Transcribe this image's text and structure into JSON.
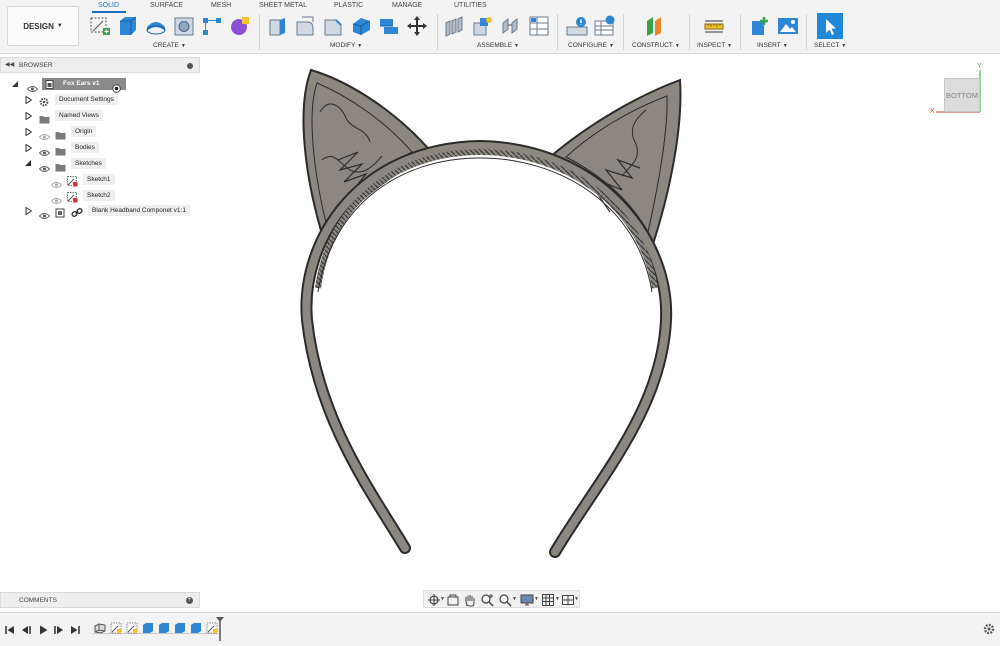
{
  "toolbar": {
    "design_label": "DESIGN",
    "tabs": [
      {
        "label": "SOLID",
        "active": true
      },
      {
        "label": "SURFACE"
      },
      {
        "label": "MESH"
      },
      {
        "label": "SHEET METAL"
      },
      {
        "label": "PLASTIC"
      },
      {
        "label": "MANAGE"
      },
      {
        "label": "UTILITIES"
      }
    ],
    "groups": [
      {
        "label": "CREATE",
        "icons": [
          "create-sketch-icon",
          "extrude-icon",
          "revolve-icon",
          "hole-icon",
          "rectangle-pattern-icon",
          "create-form-icon"
        ]
      },
      {
        "label": "MODIFY",
        "icons": [
          "press-pull-icon",
          "fillet-icon",
          "chamfer-icon",
          "shell-icon",
          "combine-icon",
          "move-copy-icon"
        ]
      },
      {
        "label": "ASSEMBLE",
        "icons": [
          "new-component-icon",
          "joint-icon",
          "as-built-joint-icon",
          "joint-origin-icon"
        ]
      },
      {
        "label": "CONFIGURE",
        "icons": [
          "configure-icon",
          "configuration-table-icon"
        ]
      },
      {
        "label": "CONSTRUCT",
        "icons": [
          "offset-plane-icon"
        ]
      },
      {
        "label": "INSPECT",
        "icons": [
          "measure-icon"
        ]
      },
      {
        "label": "INSERT",
        "icons": [
          "insert-derive-icon",
          "insert-image-icon"
        ]
      },
      {
        "label": "SELECT",
        "icons": [
          "select-arrow-icon"
        ]
      }
    ],
    "accent_color": "#1a6fc4"
  },
  "browser": {
    "title": "BROWSER",
    "root": "Fox Ears v1",
    "items": [
      {
        "label": "Document Settings",
        "icon": "gear-icon"
      },
      {
        "label": "Named Views",
        "icon": "folder-icon"
      },
      {
        "label": "Origin",
        "icon": "folder-icon"
      },
      {
        "label": "Bodies",
        "icon": "folder-icon"
      },
      {
        "label": "Sketches",
        "icon": "folder-icon"
      },
      {
        "label": "Sketch1",
        "icon": "sketch-icon"
      },
      {
        "label": "Sketch2",
        "icon": "sketch-icon"
      },
      {
        "label": "Blank Headband Componet v1:1",
        "icon": "component-link-icon"
      }
    ]
  },
  "comments": {
    "title": "COMMENTS"
  },
  "viewcube": {
    "face": "BOTTOM",
    "x_axis": "X",
    "y_axis": "Y"
  },
  "navbar": {
    "icons": [
      "orbit-icon",
      "look-at-icon",
      "pan-icon",
      "zoom-window-icon",
      "fit-icon",
      "display-settings-icon",
      "grid-icon",
      "viewports-icon"
    ]
  },
  "timeline": {
    "controls": [
      "skip-start-icon",
      "step-back-icon",
      "play-icon",
      "step-forward-icon",
      "skip-end-icon"
    ],
    "features": [
      "component-feature-icon",
      "sketch-feature-icon",
      "sketch-feature-icon",
      "extrude-feature-icon",
      "extrude-feature-icon",
      "extrude-feature-icon",
      "extrude-feature-icon",
      "sketch-feature-icon"
    ]
  },
  "colors": {
    "model_fill": "#8c877f",
    "model_stroke": "#2b2b2b",
    "toolbar_bg": "#f3f3f3"
  }
}
